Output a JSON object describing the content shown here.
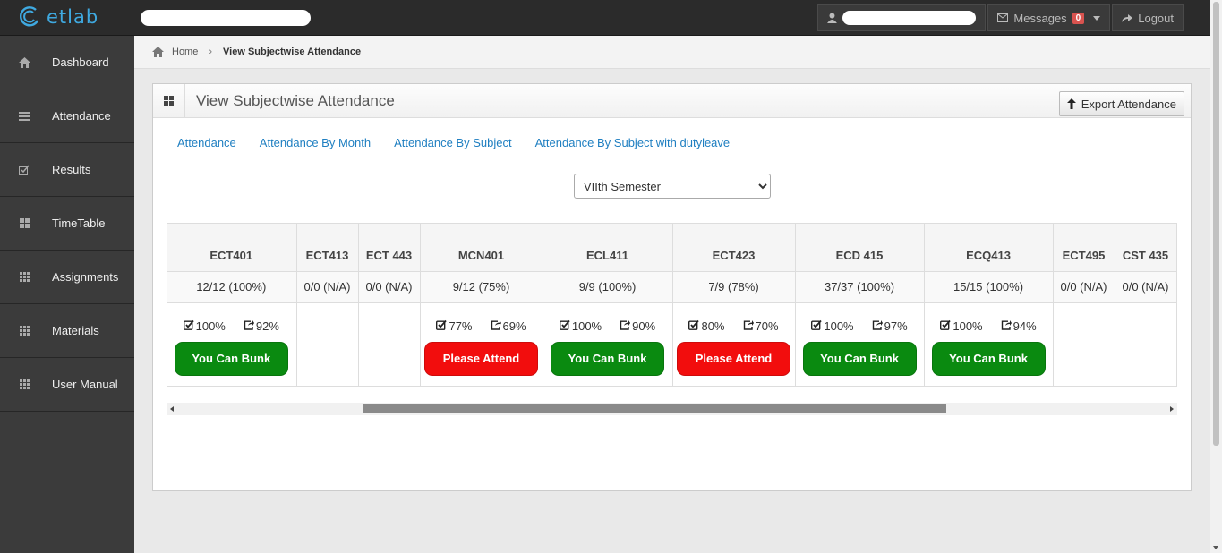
{
  "brand": {
    "name": "etlab",
    "color": "#3fa9e0"
  },
  "topbar": {
    "messages_label": "Messages",
    "messages_count": "0",
    "logout_label": "Logout"
  },
  "sidebar": {
    "items": [
      {
        "label": "Dashboard",
        "icon": "home-icon"
      },
      {
        "label": "Attendance",
        "icon": "list-icon"
      },
      {
        "label": "Results",
        "icon": "edit-check-icon"
      },
      {
        "label": "TimeTable",
        "icon": "grid-icon"
      },
      {
        "label": "Assignments",
        "icon": "apps-icon"
      },
      {
        "label": "Materials",
        "icon": "apps-icon"
      },
      {
        "label": "User Manual",
        "icon": "apps-icon"
      }
    ]
  },
  "breadcrumb": {
    "home": "Home",
    "current": "View Subjectwise Attendance"
  },
  "panel": {
    "title": "View Subjectwise Attendance",
    "export_label": "Export Attendance",
    "tabs": [
      "Attendance",
      "Attendance By Month",
      "Attendance By Subject",
      "Attendance By Subject with dutyleave"
    ],
    "semester": "VIIth Semester"
  },
  "colors": {
    "bunk": "#0a8a10",
    "attend": "#f20d0d",
    "link": "#1f7fc1"
  },
  "subjects": [
    {
      "code": "ECT401",
      "ratio": "12/12 (100%)",
      "p1": "100%",
      "p2": "92%",
      "verdict": "You Can Bunk",
      "status": "bunk"
    },
    {
      "code": "ECT413",
      "ratio": "0/0 (N/A)",
      "p1": "",
      "p2": "",
      "verdict": "",
      "status": "none"
    },
    {
      "code": "ECT 443",
      "ratio": "0/0 (N/A)",
      "p1": "",
      "p2": "",
      "verdict": "",
      "status": "none"
    },
    {
      "code": "MCN401",
      "ratio": "9/12 (75%)",
      "p1": "77%",
      "p2": "69%",
      "verdict": "Please Attend",
      "status": "attend"
    },
    {
      "code": "ECL411",
      "ratio": "9/9 (100%)",
      "p1": "100%",
      "p2": "90%",
      "verdict": "You Can Bunk",
      "status": "bunk"
    },
    {
      "code": "ECT423",
      "ratio": "7/9 (78%)",
      "p1": "80%",
      "p2": "70%",
      "verdict": "Please Attend",
      "status": "attend"
    },
    {
      "code": "ECD 415",
      "ratio": "37/37 (100%)",
      "p1": "100%",
      "p2": "97%",
      "verdict": "You Can Bunk",
      "status": "bunk"
    },
    {
      "code": "ECQ413",
      "ratio": "15/15 (100%)",
      "p1": "100%",
      "p2": "94%",
      "verdict": "You Can Bunk",
      "status": "bunk"
    },
    {
      "code": "ECT495",
      "ratio": "0/0 (N/A)",
      "p1": "",
      "p2": "",
      "verdict": "",
      "status": "none"
    },
    {
      "code": "CST 435",
      "ratio": "0/0 (N/A)",
      "p1": "",
      "p2": "",
      "verdict": "",
      "status": "none"
    }
  ]
}
